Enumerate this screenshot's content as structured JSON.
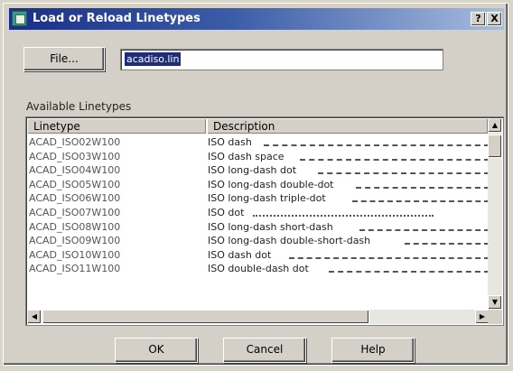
{
  "window": {
    "title": "Load or Reload Linetypes",
    "help_btn": "?",
    "close_btn": "X"
  },
  "file": {
    "button_label": "File...",
    "value": "acadiso.lin"
  },
  "available_label": "Available Linetypes",
  "columns": {
    "linetype": "Linetype",
    "description": "Description"
  },
  "rows": [
    {
      "linetype": "ACAD_ISO02W100",
      "description": "ISO dash"
    },
    {
      "linetype": "ACAD_ISO03W100",
      "description": "ISO dash space"
    },
    {
      "linetype": "ACAD_ISO04W100",
      "description": "ISO long-dash dot"
    },
    {
      "linetype": "ACAD_ISO05W100",
      "description": "ISO long-dash double-dot"
    },
    {
      "linetype": "ACAD_ISO06W100",
      "description": "ISO long-dash triple-dot"
    },
    {
      "linetype": "ACAD_ISO07W100",
      "description": "ISO dot"
    },
    {
      "linetype": "ACAD_ISO08W100",
      "description": "ISO long-dash short-dash"
    },
    {
      "linetype": "ACAD_ISO09W100",
      "description": "ISO long-dash double-short-dash"
    },
    {
      "linetype": "ACAD_ISO10W100",
      "description": "ISO dash dot"
    },
    {
      "linetype": "ACAD_ISO11W100",
      "description": "ISO double-dash dot"
    }
  ],
  "buttons": {
    "ok": "OK",
    "cancel": "Cancel",
    "help": "Help"
  }
}
